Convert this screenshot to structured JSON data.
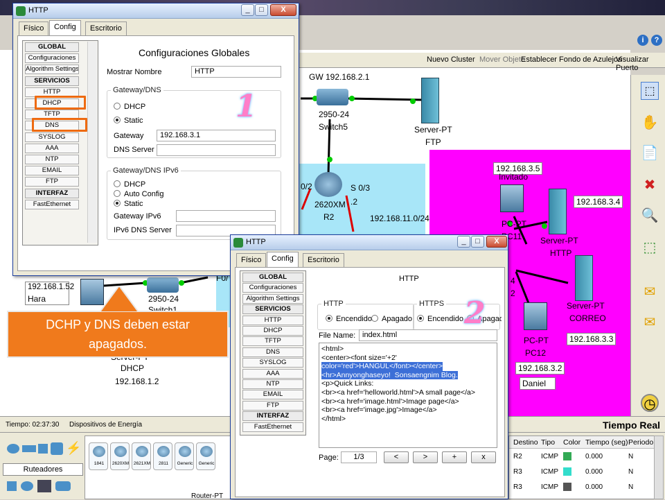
{
  "background_app": {
    "toolbar": {
      "new_cluster": "Nuevo Cluster",
      "move_object": "Mover Objeto",
      "set_tile": "Establecer Fondo de Azulejos",
      "viewport": "Visualizar Puerto"
    },
    "labels": {
      "gw": "GW 192.168.2.1",
      "switch5_model": "2950-24",
      "switch5_name": "Switch5",
      "server_ftp_model": "Server-PT",
      "server_ftp_name": "FTP",
      "router_model": "2620XM",
      "router_name": "R2",
      "port_left": "0/2",
      "port_right": "S 0/3",
      "port_right2": ".2",
      "net_11": "192.168.11.0/24",
      "invitado_ip": "192.168.3.5",
      "invitado_name": "Invitado",
      "pc11_model": "PC-PT",
      "pc11_name": "PC11",
      "server_http_ip": "192.168.3.4",
      "server_http_model": "Server-PT",
      "server_http_name": "HTTP",
      "server_correo_model": "Server-PT",
      "server_correo_name": "CORREO",
      "server_correo_ip": "192.168.3.3",
      "pc12_model": "PC-PT",
      "pc12_name": "PC12",
      "pc12_ip": "192.168.3.2",
      "pc12_user": "Daniel",
      "hara_ip": "192.168.1.52",
      "hara_name": "Hara",
      "switch1_model": "2950-24",
      "switch1_name": "Switch1",
      "dhcp_server_model": "Server-PT",
      "dhcp_server_name": "DHCP",
      "dhcp_server_ip": "192.168.1.2",
      "frag_1": "F0/",
      "frag_2": "4",
      "frag_3": "2"
    },
    "status": {
      "time": "Tiempo: 02:37:30",
      "power": "Dispositivos de Energía",
      "realtime": "Tiempo Real"
    },
    "bottom": {
      "category": "Ruteadores",
      "devices": [
        "1841",
        "2620XM",
        "2621XM",
        "2811",
        "Generic",
        "Generic"
      ],
      "selected_model": "Router-PT",
      "pdu_headers": [
        "Destino",
        "Tipo",
        "Color",
        "Tiempo (seg)",
        "Periodo"
      ],
      "pdu_rows": [
        {
          "dest": "R2",
          "type": "ICMP",
          "color": "#33aa55",
          "time": "0.000",
          "period": "N"
        },
        {
          "dest": "R3",
          "type": "ICMP",
          "color": "#33ddcc",
          "time": "0.000",
          "period": "N"
        },
        {
          "dest": "R3",
          "type": "ICMP",
          "color": "#555555",
          "time": "0.000",
          "period": "N"
        }
      ]
    }
  },
  "window1": {
    "title": "HTTP",
    "tabs": [
      "Físico",
      "Config",
      "Escritorio"
    ],
    "menu": [
      "GLOBAL",
      "Configuraciones",
      "Algorithm Settings",
      "SERVICIOS",
      "HTTP",
      "DHCP",
      "TFTP",
      "DNS",
      "SYSLOG",
      "AAA",
      "NTP",
      "EMAIL",
      "FTP",
      "INTERFAZ",
      "FastEthernet"
    ],
    "heading": "Configuraciones Globales",
    "display_name_label": "Mostrar Nombre",
    "display_name_value": "HTTP",
    "gw_dns_legend": "Gateway/DNS",
    "dhcp_label": "DHCP",
    "static_label": "Static",
    "gateway_label": "Gateway",
    "gateway_value": "192.168.3.1",
    "dns_label": "DNS Server",
    "dns_value": "",
    "ipv6_legend": "Gateway/DNS IPv6",
    "ipv6_dhcp": "DHCP",
    "ipv6_auto": "Auto Config",
    "ipv6_static": "Static",
    "ipv6_gateway_label": "Gateway IPv6",
    "ipv6_dns_label": "IPv6 DNS Server",
    "number": "1"
  },
  "window2": {
    "title": "HTTP",
    "tabs": [
      "Físico",
      "Config",
      "Escritorio"
    ],
    "menu": [
      "GLOBAL",
      "Configuraciones",
      "Algorithm Settings",
      "SERVICIOS",
      "HTTP",
      "DHCP",
      "TFTP",
      "DNS",
      "SYSLOG",
      "AAA",
      "NTP",
      "EMAIL",
      "FTP",
      "INTERFAZ",
      "FastEthernet"
    ],
    "heading": "HTTP",
    "http_legend": "HTTP",
    "https_legend": "HTTPS",
    "http_on": "Encendido",
    "http_off": "Apagado",
    "https_on": "Encendido",
    "https_off": "Apagado",
    "file_label": "File Name:",
    "file_value": "index.html",
    "code_lines": [
      "<html>",
      "<center><font size='+2'",
      "color='red'>HANGUL</font></center>",
      "<hr>Annyonghaseyo!  Sonsaengnim Blog.",
      "<p>Quick Links:",
      "<br><a href='helloworld.html'>A small page</a>",
      "<br><a href='image.html'>Image page</a>",
      "<br><a href='image.jpg'>Image</a>",
      "</html>"
    ],
    "page_label": "Page:",
    "page_value": "1/3",
    "prev": "<",
    "next": ">",
    "add": "+",
    "remove": "x",
    "number": "2"
  },
  "callout": {
    "line1": "DCHP y DNS deben estar",
    "line2": "apagados."
  },
  "colors": {
    "highlight": "#ee6a10",
    "magenta_zone": "#ff00ff",
    "cyan_zone": "#a8e6f8",
    "link": "#00cc00",
    "selection": "#3c6fd7"
  }
}
